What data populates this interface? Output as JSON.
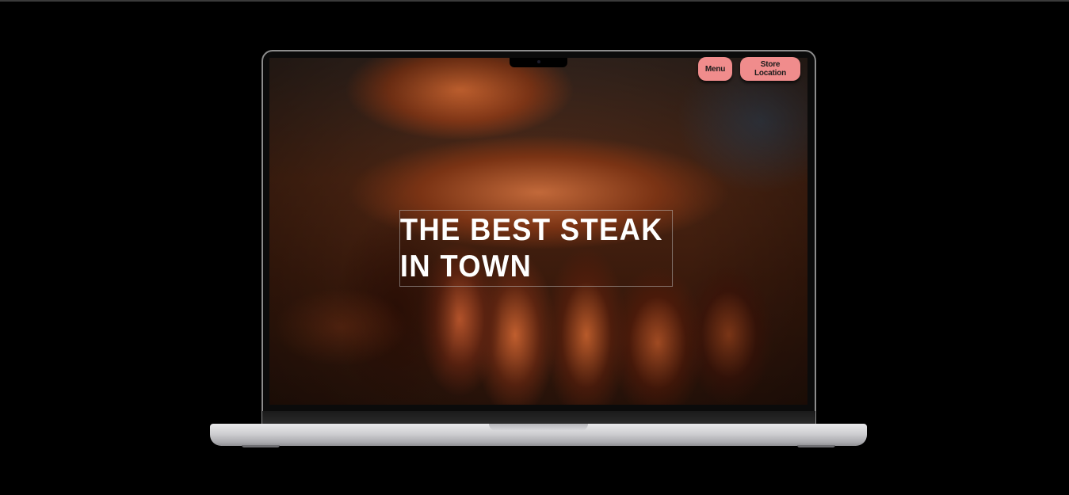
{
  "nav": {
    "menu_label": "Menu",
    "store_location_label": "Store Location",
    "button_color": "#f08c8c"
  },
  "hero": {
    "title": "THE BEST STEAK IN TOWN",
    "background_image": "grilled sliced steak on wooden board"
  },
  "device": {
    "type": "laptop-mockup"
  }
}
